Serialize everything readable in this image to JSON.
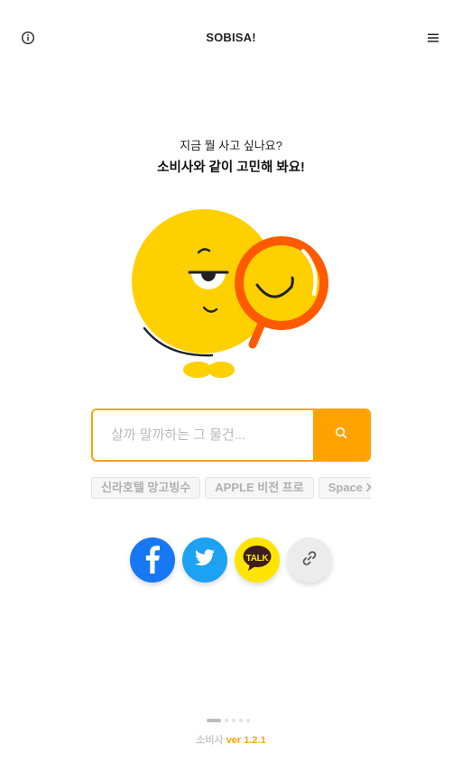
{
  "header": {
    "title": "SOBISA!",
    "info_icon": "info-circle-icon",
    "menu_icon": "hamburger-menu-icon"
  },
  "hero": {
    "subtitle": "지금 뭘 사고 싶나요?",
    "title": "소비사와 같이 고민해 봐요!"
  },
  "search": {
    "placeholder": "살까 말까하는 그 물건...",
    "value": "",
    "button_icon": "search-icon"
  },
  "suggestions": [
    "신라호텔 망고빙수",
    "APPLE 비전 프로",
    "Space X 화"
  ],
  "share": {
    "facebook_icon": "facebook-icon",
    "twitter_icon": "twitter-icon",
    "kakaotalk_label": "TALK",
    "link_icon": "link-icon"
  },
  "pager": {
    "total": 5,
    "active": 1
  },
  "footer": {
    "app_name": "소비사",
    "version": "ver 1.2.1"
  },
  "colors": {
    "accent": "#ffa200",
    "mascot": "#ffd000",
    "magnifier": "#ff5a00",
    "facebook": "#1877f2",
    "twitter": "#1da1f2",
    "kakao": "#fee500"
  }
}
